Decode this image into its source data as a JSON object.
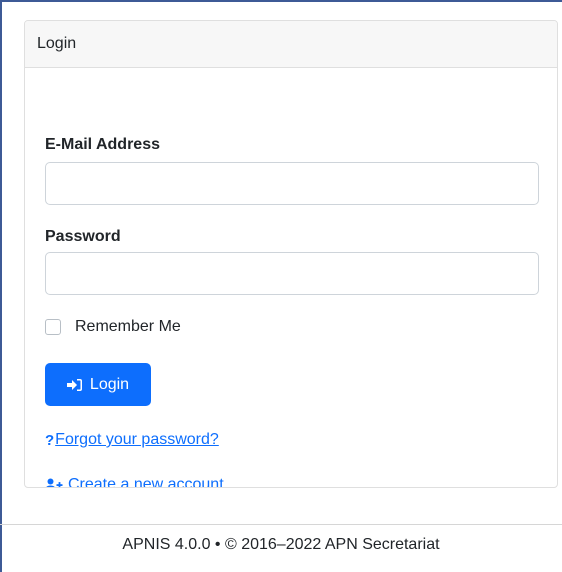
{
  "card": {
    "header": "Login"
  },
  "form": {
    "email_label": "E-Mail Address",
    "email_value": "",
    "email_placeholder": "",
    "password_label": "Password",
    "password_value": "",
    "password_placeholder": "",
    "remember_label": "Remember Me",
    "remember_checked": false,
    "login_button": "Login"
  },
  "links": {
    "forgot_password": "Forgot your password?",
    "create_account": "Create a new account"
  },
  "footer": {
    "text": "APNIS 4.0.0 • © 2016–2022 APN Secretariat"
  },
  "icons": {
    "login": "sign-in-icon",
    "forgot": "question-icon",
    "create": "user-plus-icon"
  },
  "colors": {
    "primary": "#0d6efd",
    "header_bg": "#f7f7f7",
    "border": "#dfdfdf"
  }
}
